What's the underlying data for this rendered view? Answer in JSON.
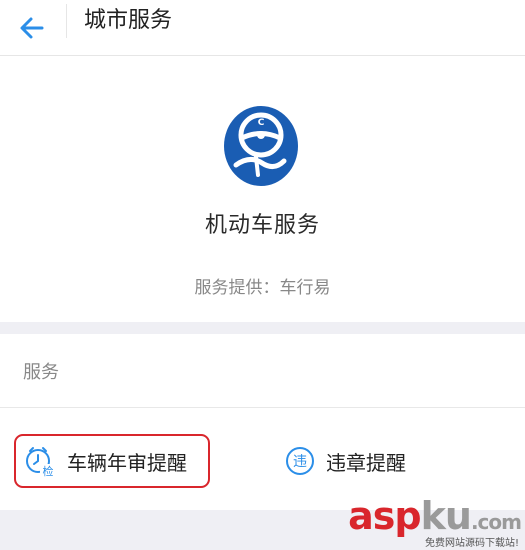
{
  "header": {
    "title": "城市服务"
  },
  "service": {
    "name": "机动车服务",
    "provider": "服务提供：车行易",
    "logo_color": "#1a5db3"
  },
  "section": {
    "title": "服务"
  },
  "services": [
    {
      "label": "车辆年审提醒",
      "icon": "annual-inspection-icon",
      "highlighted": true
    },
    {
      "label": "违章提醒",
      "icon": "violation-icon",
      "highlighted": false
    }
  ],
  "watermark": {
    "part1": "asp",
    "part2": "ku",
    "part3": ".com",
    "subtitle": "免费网站源码下载站!"
  },
  "colors": {
    "accent_blue": "#2b8ee8",
    "highlight_red": "#d9262c"
  }
}
